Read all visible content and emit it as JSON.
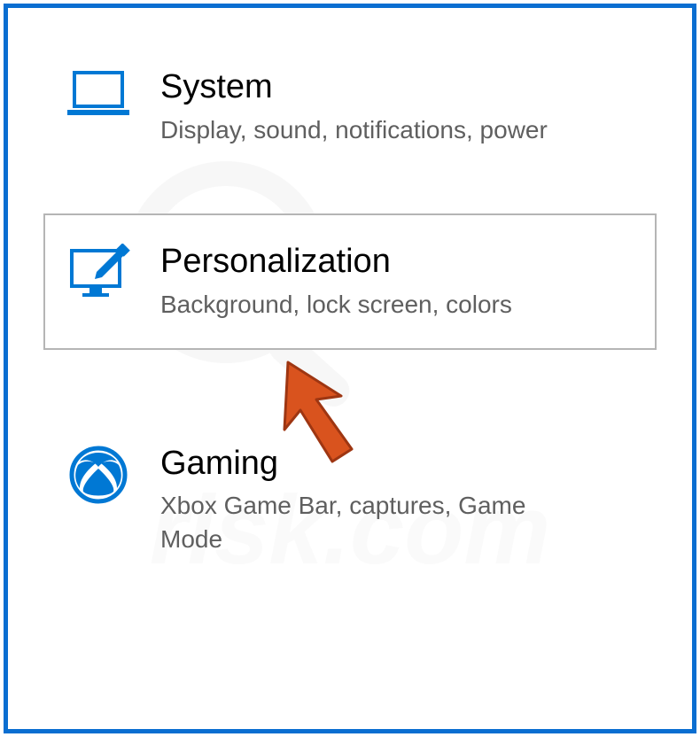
{
  "settings": {
    "items": [
      {
        "title": "System",
        "description": "Display, sound, notifications, power",
        "icon": "laptop-icon",
        "selected": false
      },
      {
        "title": "Personalization",
        "description": "Background, lock screen, colors",
        "icon": "personalization-icon",
        "selected": true
      },
      {
        "title": "Gaming",
        "description": "Xbox Game Bar, captures, Game Mode",
        "icon": "xbox-icon",
        "selected": false
      }
    ]
  },
  "colors": {
    "frameBorder": "#0a6ed1",
    "iconBlue": "#0078d4",
    "xboxGreen": "#107c10",
    "cursorOrange": "#d9531e",
    "selectedBorder": "#b5b5b5"
  },
  "watermarkText": "PCrisk.com"
}
